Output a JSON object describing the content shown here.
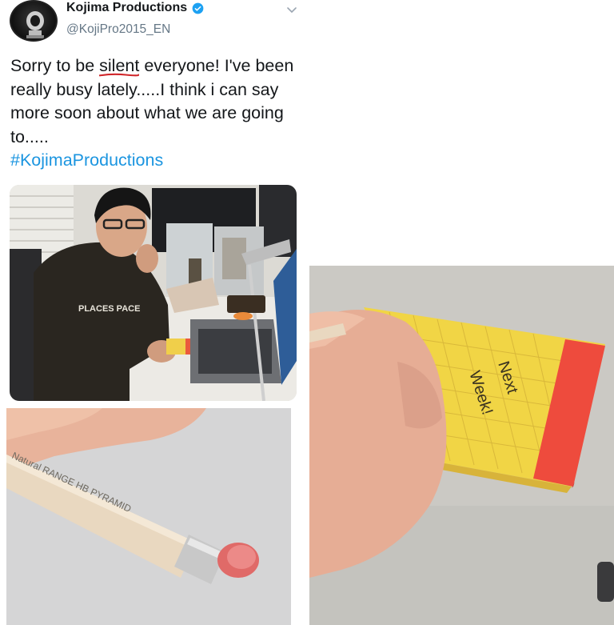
{
  "account": {
    "display_name": "Kojima Productions",
    "handle": "@KojiPro2015_EN",
    "verified": true,
    "avatar_icon": "kojima-productions-logo-icon"
  },
  "tweet": {
    "text_before": "Sorry to be ",
    "underlined_word": "silent",
    "text_after": " everyone! I've been really busy lately.....I think i can say more soon about what we are going to.....",
    "hashtag": "#KojimaProductions"
  },
  "photo": {
    "hoodie_text": "PLACES PACE"
  },
  "pencil": {
    "imprint": "Natural RANGE HB PYRAMID"
  },
  "notepad": {
    "handwriting_line1": "Next",
    "handwriting_line2": "Week!"
  },
  "colors": {
    "link": "#1b95e0",
    "verified": "#1da1f2",
    "underline": "#d0262a",
    "notepad_yellow": "#f2d640",
    "notepad_red": "#ef4a3e"
  }
}
